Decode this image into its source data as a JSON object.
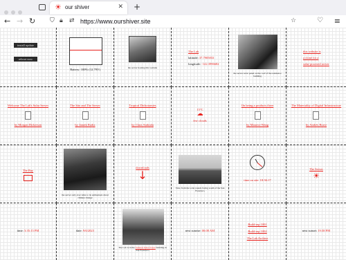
{
  "browser": {
    "tab_title": "our shiver",
    "url": "https://www.ourshiver.site"
  },
  "row1": {
    "buttons": [
      "install update",
      "reboot now"
    ],
    "battery": "Battery: 100% (12.79V)",
    "photo1_caption": "the server hosting this website",
    "location": {
      "name": "The Lab",
      "latitude_label": "latitude:",
      "latitude": "37.7905833",
      "longitude_label": "longitude:",
      "longitude": "-122.3996682"
    },
    "photo2_caption": "the server solar panel on the roof of the residence building",
    "about": [
      "this website is",
      "a clone for a",
      "solar-powered server"
    ]
  },
  "row2": {
    "doc1": {
      "title": "Welcome The Lab's Solar Server",
      "author": "by Morgan Dickerson"
    },
    "doc2": {
      "title": "The Site and The Server",
      "author": "by Jannik Radix"
    },
    "doc3": {
      "title": "Tropical Dichotomies",
      "author": "by Clara Andrada"
    },
    "weather": {
      "temp": "15°C",
      "desc": "few clouds"
    },
    "doc4": {
      "title": "On being a products there",
      "author": "by Maurice Wang"
    },
    "doc5": {
      "title": "The Materiality of Digital Infrastructure",
      "author": "by Andrés Brave"
    }
  },
  "row3": {
    "map_title": "The Bay",
    "photo3_caption": "the server only ever talks to its enthusiasts about climate change",
    "downloads_label": "downloads",
    "photo4_caption": "View from the solar panels facing south of the San Francisco",
    "time": "time on site: 18:36:17",
    "sun_label": "The Server"
  },
  "row4": {
    "time_label": "time:",
    "time_value": "3:35:15 PM",
    "date_label": "date:",
    "date_value": "9/6/2023",
    "photo5_caption_prefix": "The Lab is in the",
    "photo5_caption_link": "Jackson Solar Tower",
    "photo5_caption_suffix": "building in San Francisco",
    "sunrise_label": "next sunrise:",
    "sunrise_value": "06:00 AM",
    "links": [
      "Build-rep 1001",
      "Build-rep 1002",
      "The Lab Archive"
    ],
    "sunset_label": "next sunset:",
    "sunset_value": "19:38 PM"
  },
  "colors": {
    "accent": "#e8201c",
    "tab_bg": "#f0f0f4"
  }
}
